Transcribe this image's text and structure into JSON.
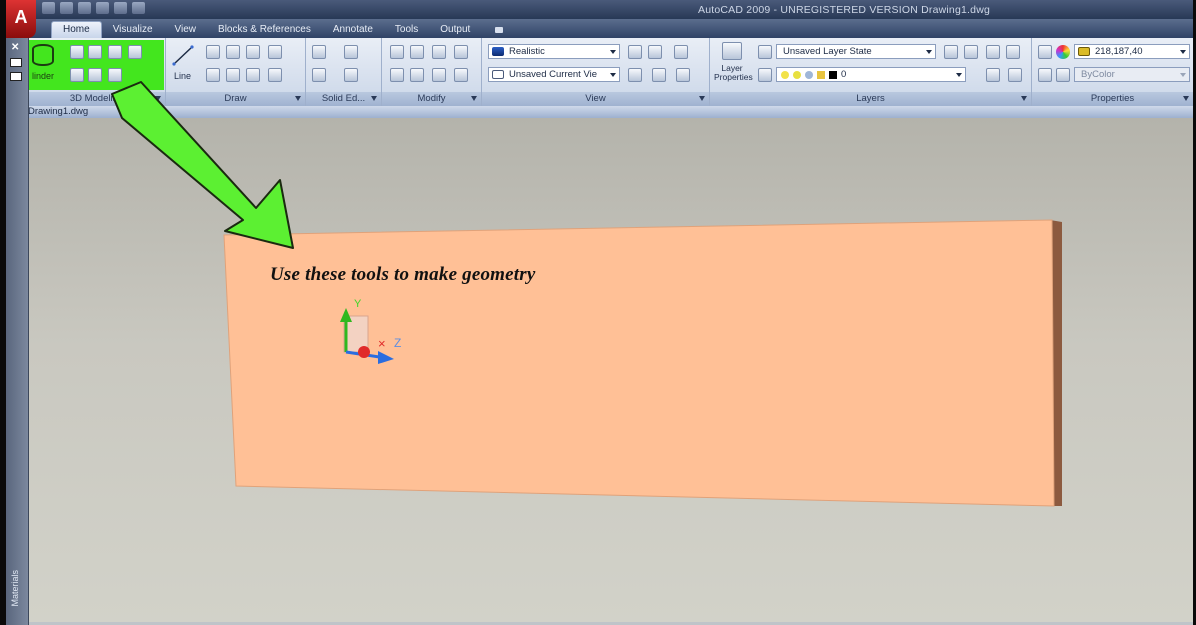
{
  "window": {
    "app_button": "A",
    "title": "AutoCAD 2009 - UNREGISTERED VERSION Drawing1.dwg"
  },
  "ribbon_tabs": [
    {
      "label": "Home",
      "active": true
    },
    {
      "label": "Visualize"
    },
    {
      "label": "View"
    },
    {
      "label": "Blocks & References"
    },
    {
      "label": "Annotate"
    },
    {
      "label": "Tools"
    },
    {
      "label": "Output"
    }
  ],
  "panels": {
    "modeling": {
      "title": "3D Modeling",
      "cylinder_label": "linder",
      "highlight_color": "#43e61e"
    },
    "draw": {
      "title": "Draw",
      "line_label": "Line"
    },
    "solid_editing": {
      "title": "Solid Ed..."
    },
    "modify": {
      "title": "Modify"
    },
    "view": {
      "title": "View",
      "visual_style": "Realistic",
      "named_view": "Unsaved Current Vie"
    },
    "layers": {
      "title": "Layers",
      "layer_properties_label": "Layer Properties",
      "layer_state": "Unsaved Layer State",
      "current_layer": "0"
    },
    "properties": {
      "title": "Properties",
      "color_value": "218,187,40",
      "color_swatch": "#dabb28",
      "linetype": "ByColor"
    }
  },
  "document_tab": "Drawing1.dwg",
  "palette": {
    "label": "Materials"
  },
  "viewport": {
    "caption": "Use these tools to make geometry",
    "ucs": {
      "y_label": "Y",
      "z_label": "Z",
      "x_label": "×"
    },
    "solid_color": "#ffc096",
    "arrow_color": "#5cf032"
  }
}
